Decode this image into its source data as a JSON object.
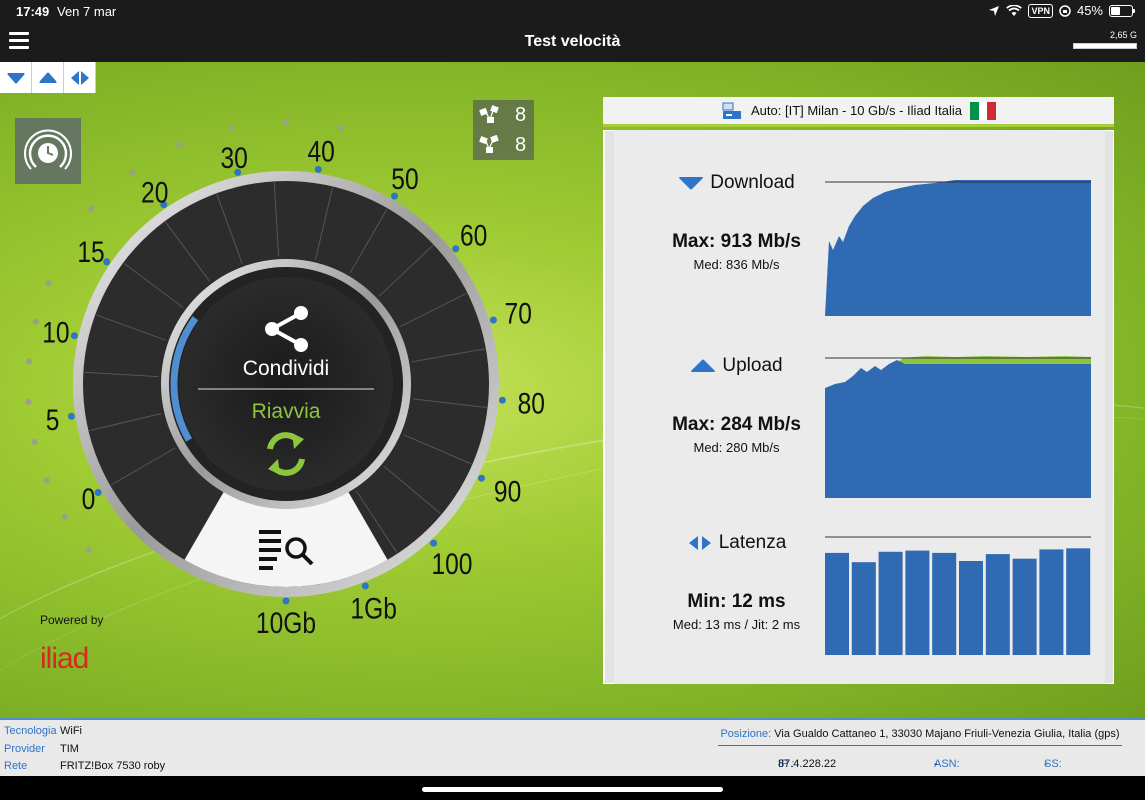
{
  "status": {
    "time": "17:49",
    "date": "Ven 7 mar",
    "vpn": "VPN",
    "battery": "45%",
    "battery_level": 0.45
  },
  "header": {
    "title": "Test velocità",
    "usage": "2,65 G",
    "usage_level": 1.0
  },
  "filters": {
    "download_icon": "triangle-down-icon",
    "upload_icon": "triangle-up-icon",
    "latency_icon": "latency-arrows-icon"
  },
  "servers": {
    "count_1": "8",
    "count_2": "8"
  },
  "gauge": {
    "scale_labels": [
      "0",
      "5",
      "10",
      "15",
      "20",
      "30",
      "40",
      "50",
      "60",
      "70",
      "80",
      "90",
      "100",
      "1Gb",
      "10Gb"
    ],
    "share_label": "Condividi",
    "restart_label": "Riavvia",
    "progress": 0.22
  },
  "powered_by": "Powered by",
  "brand": "iliad",
  "server_info": {
    "text": "Auto: [IT] Milan - 10 Gb/s - Iliad Italia"
  },
  "download": {
    "label": "Download",
    "max": "Max: 913 Mb/s",
    "avg": "Med: 836 Mb/s"
  },
  "upload": {
    "label": "Upload",
    "max": "Max: 284 Mb/s",
    "avg": "Med: 280 Mb/s"
  },
  "latency": {
    "label": "Latenza",
    "min": "Min: 12 ms",
    "avg": "Med: 13 ms / Jit: 2 ms"
  },
  "footer": {
    "tech_label": "Tecnologia",
    "tech_value": "WiFi",
    "provider_label": "Provider",
    "provider_value": "TIM",
    "network_label": "Rete",
    "network_value": "FRITZ!Box 7530 roby",
    "position_label": "Posizione:",
    "position_value": "Via Gualdo Cattaneo 1, 33030 Majano Friuli-Venezia Giulia, Italia (gps)",
    "ip_label": "IP :",
    "ip_value": "87.4.228.22",
    "asn_label": "ASN:",
    "asn_value": "-",
    "ss_label": "SS:",
    "ss_value": "-"
  },
  "colors": {
    "accent_green": "#8cc63f",
    "chart_blue": "#2f6ab3",
    "brand_red": "#d52b1e"
  }
}
